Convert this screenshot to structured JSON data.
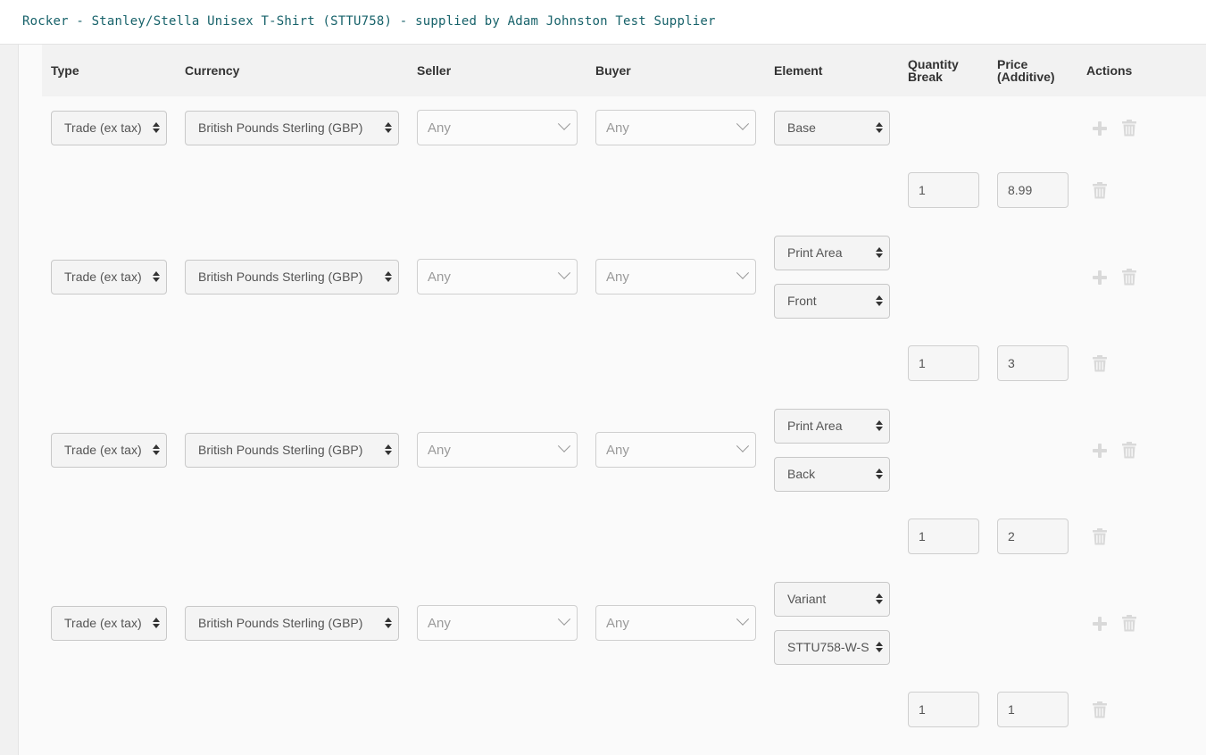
{
  "header": {
    "title": "Rocker - Stanley/Stella Unisex T-Shirt (STTU758) - supplied by Adam Johnston Test Supplier"
  },
  "columns": {
    "type": "Type",
    "currency": "Currency",
    "seller": "Seller",
    "buyer": "Buyer",
    "element": "Element",
    "quantity_break": [
      "Quantity",
      "Break"
    ],
    "price": [
      "Price",
      "(Additive)"
    ],
    "actions": "Actions"
  },
  "rules": [
    {
      "type": "Trade (ex tax)",
      "currency": "British Pounds Sterling (GBP)",
      "seller": "Any",
      "buyer": "Any",
      "element": [
        "Base"
      ],
      "breaks": [
        {
          "quantity": "1",
          "price": "8.99"
        }
      ]
    },
    {
      "type": "Trade (ex tax)",
      "currency": "British Pounds Sterling (GBP)",
      "seller": "Any",
      "buyer": "Any",
      "element": [
        "Print Area",
        "Front"
      ],
      "breaks": [
        {
          "quantity": "1",
          "price": "3"
        }
      ]
    },
    {
      "type": "Trade (ex tax)",
      "currency": "British Pounds Sterling (GBP)",
      "seller": "Any",
      "buyer": "Any",
      "element": [
        "Print Area",
        "Back"
      ],
      "breaks": [
        {
          "quantity": "1",
          "price": "2"
        }
      ]
    },
    {
      "type": "Trade (ex tax)",
      "currency": "British Pounds Sterling (GBP)",
      "seller": "Any",
      "buyer": "Any",
      "element": [
        "Variant",
        "STTU758-W-S"
      ],
      "breaks": [
        {
          "quantity": "1",
          "price": "1"
        }
      ]
    }
  ],
  "icons": {
    "add": "plus-icon",
    "delete": "trash-icon"
  },
  "colors": {
    "title": "#17626a",
    "icon": "#d9d9d9",
    "border": "#c8c8c8"
  }
}
